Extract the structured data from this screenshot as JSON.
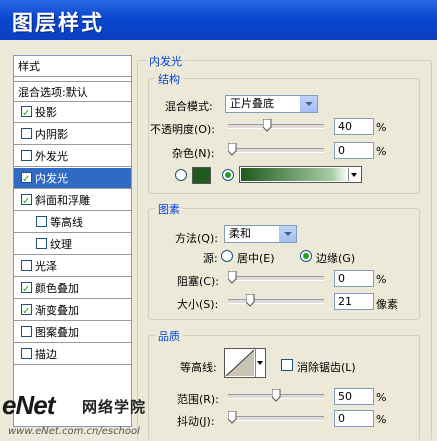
{
  "window": {
    "title": "图层样式"
  },
  "left_panel": {
    "header": "样式",
    "blend_default": "混合选项:默认",
    "items": [
      {
        "label": "投影",
        "checked": true
      },
      {
        "label": "内阴影",
        "checked": false
      },
      {
        "label": "外发光",
        "checked": false
      },
      {
        "label": "内发光",
        "checked": true,
        "selected": true
      },
      {
        "label": "斜面和浮雕",
        "checked": true
      },
      {
        "label": "等高线",
        "checked": false,
        "sub": true
      },
      {
        "label": "纹理",
        "checked": false,
        "sub": true
      },
      {
        "label": "光泽",
        "checked": false
      },
      {
        "label": "颜色叠加",
        "checked": true
      },
      {
        "label": "渐变叠加",
        "checked": true
      },
      {
        "label": "图案叠加",
        "checked": false
      },
      {
        "label": "描边",
        "checked": false
      }
    ]
  },
  "inner_glow": {
    "title": "内发光",
    "structure": {
      "title": "结构",
      "blend_mode_label": "混合模式:",
      "blend_mode_value": "正片叠底",
      "opacity_label": "不透明度(O):",
      "opacity_value": "40",
      "opacity_unit": "%",
      "opacity_level": 40,
      "noise_label": "杂色(N):",
      "noise_value": "0",
      "noise_unit": "%",
      "noise_level": 0,
      "color_mode": "gradient",
      "swatch_color": "#1e5a1c"
    },
    "elements": {
      "title": "图素",
      "technique_label": "方法(Q):",
      "technique_value": "柔和",
      "source_label": "源:",
      "source_center": "居中(E)",
      "source_edge": "边缘(G)",
      "choke_label": "阻塞(C):",
      "choke_value": "0",
      "choke_unit": "%",
      "choke_level": 0,
      "size_label": "大小(S):",
      "size_value": "21",
      "size_unit": "像素",
      "size_level": 21
    },
    "quality": {
      "title": "品质",
      "contour_label": "等高线:",
      "antialias_label": "消除锯齿(L)",
      "range_label": "范围(R):",
      "range_value": "50",
      "range_unit": "%",
      "range_level": 50,
      "jitter_label": "抖动(J):",
      "jitter_value": "0",
      "jitter_unit": "%",
      "jitter_level": 0
    }
  },
  "watermark": {
    "logo": "eNet",
    "cn": "网络学院",
    "url": "www.eNet.com.cn/eschool"
  }
}
